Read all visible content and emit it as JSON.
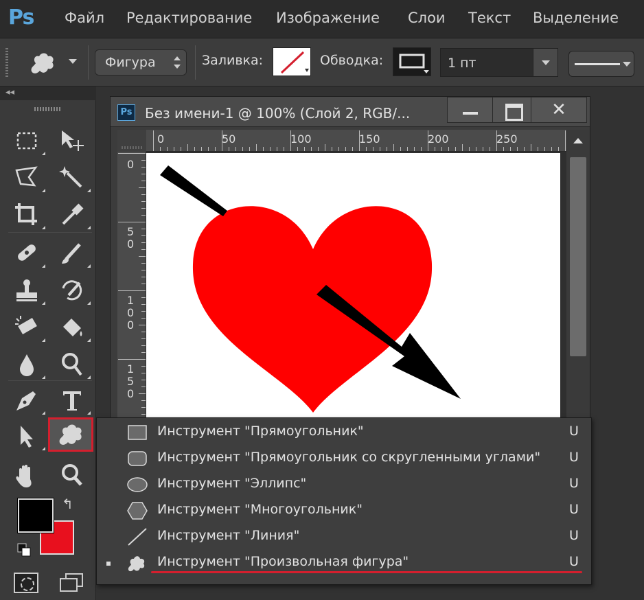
{
  "app": {
    "logo": "Ps",
    "accent_color": "#5aa6dc",
    "highlight_color": "#d41f2e"
  },
  "menubar": {
    "items": [
      "Файл",
      "Редактирование",
      "Изображение",
      "Слои",
      "Текст",
      "Выделение"
    ]
  },
  "options_bar": {
    "tool_icon": "custom-shape-icon",
    "mode_select": "Фигура",
    "fill_label": "Заливка:",
    "fill_value": "none",
    "stroke_label": "Обводка:",
    "stroke_width": "1 пт",
    "stroke_style": "solid-line"
  },
  "document": {
    "ps_badge": "Ps",
    "title": "Без имени-1 @ 100% (Слой 2, RGB/...",
    "window_buttons": {
      "minimize": "minimize",
      "maximize": "maximize",
      "close": "✕"
    },
    "ruler_top": [
      "0",
      "50",
      "100",
      "150",
      "200",
      "250"
    ],
    "ruler_left": [
      "0",
      "5\n0",
      "1\n0\n0",
      "1\n5\n0"
    ],
    "shapes": {
      "heart_color": "#ff0000",
      "arrow_color": "#000000"
    }
  },
  "toolbox": {
    "collapse": "◂◂",
    "tools": [
      "marquee-icon",
      "move-icon",
      "lasso-icon",
      "magic-wand-icon",
      "crop-icon",
      "eyedropper-icon",
      "healing-brush-icon",
      "brush-icon",
      "clone-stamp-icon",
      "history-brush-icon",
      "eraser-icon",
      "paint-bucket-icon",
      "blur-icon",
      "dodge-icon",
      "pen-icon",
      "type-icon",
      "path-selection-icon",
      "custom-shape-icon",
      "hand-icon",
      "zoom-icon"
    ],
    "foreground_color": "#000000",
    "background_color": "#e8101e",
    "swap_glyph": "↰"
  },
  "flyout": {
    "items": [
      {
        "label": "Инструмент \"Прямоугольник\"",
        "key": "U",
        "icon": "rectangle-icon",
        "selected": false
      },
      {
        "label": "Инструмент \"Прямоугольник со скругленными углами\"",
        "key": "U",
        "icon": "rounded-rectangle-icon",
        "selected": false
      },
      {
        "label": "Инструмент \"Эллипс\"",
        "key": "U",
        "icon": "ellipse-icon",
        "selected": false
      },
      {
        "label": "Инструмент \"Многоугольник\"",
        "key": "U",
        "icon": "polygon-icon",
        "selected": false
      },
      {
        "label": "Инструмент \"Линия\"",
        "key": "U",
        "icon": "line-icon",
        "selected": false
      },
      {
        "label": "Инструмент \"Произвольная фигура\"",
        "key": "U",
        "icon": "custom-shape-icon",
        "selected": true
      }
    ]
  }
}
